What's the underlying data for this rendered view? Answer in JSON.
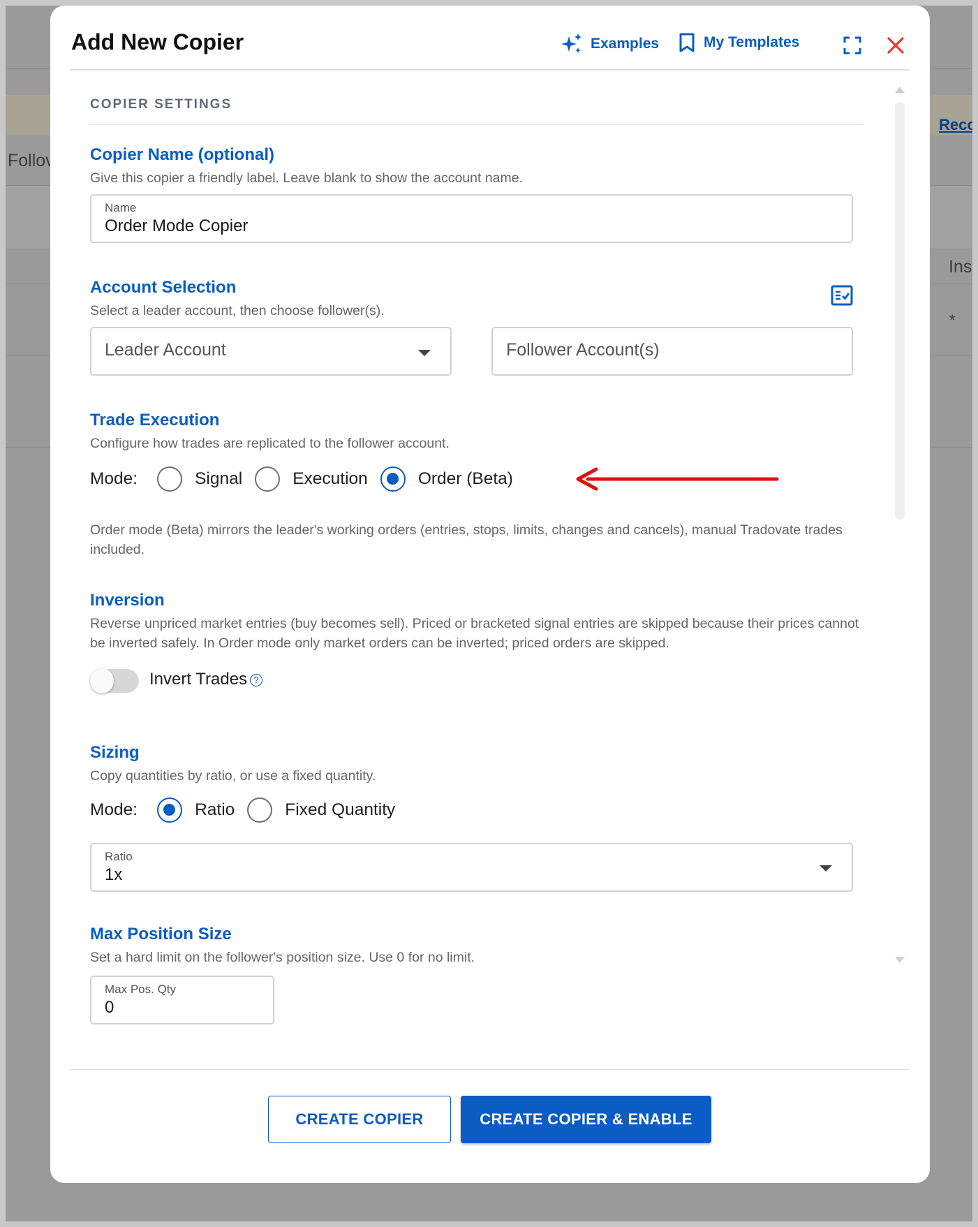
{
  "background": {
    "link_text": "Reco",
    "follow_text": "Follov",
    "ins_text": "Ins",
    "asterisk": "*"
  },
  "modal": {
    "title": "Add New Copier",
    "examples_label": "Examples",
    "templates_label": "My Templates"
  },
  "settings": {
    "section_caption": "COPIER SETTINGS",
    "copier_name": {
      "heading": "Copier Name (optional)",
      "description": "Give this copier a friendly label. Leave blank to show the account name.",
      "field_label": "Name",
      "field_value": "Order Mode Copier"
    },
    "account_selection": {
      "heading": "Account Selection",
      "description": "Select a leader account, then choose follower(s).",
      "leader_placeholder": "Leader Account",
      "follower_placeholder": "Follower Account(s)"
    },
    "trade_execution": {
      "heading": "Trade Execution",
      "description": "Configure how trades are replicated to the follower account.",
      "mode_label": "Mode:",
      "options": [
        "Signal",
        "Execution",
        "Order (Beta)"
      ],
      "selected": "Order (Beta)",
      "note": "Order mode (Beta) mirrors the leader's working orders (entries, stops, limits, changes and cancels), manual Tradovate trades included."
    },
    "inversion": {
      "heading": "Inversion",
      "description": "Reverse unpriced market entries (buy becomes sell). Priced or bracketed signal entries are skipped because their prices cannot be inverted safely. In Order mode only market orders can be inverted; priced orders are skipped.",
      "toggle_label": "Invert Trades",
      "toggle_on": false,
      "help_glyph": "?"
    },
    "sizing": {
      "heading": "Sizing",
      "description": "Copy quantities by ratio, or use a fixed quantity.",
      "mode_label": "Mode:",
      "options": [
        "Ratio",
        "Fixed Quantity"
      ],
      "selected": "Ratio",
      "ratio_label": "Ratio",
      "ratio_value": "1x"
    },
    "max_position": {
      "heading": "Max Position Size",
      "description": "Set a hard limit on the follower's position size. Use 0 for no limit.",
      "field_label": "Max Pos. Qty",
      "field_value": "0"
    }
  },
  "footer": {
    "create_label": "CREATE COPIER",
    "create_enable_label": "CREATE COPIER & ENABLE"
  },
  "colors": {
    "accent": "#0a5dc2",
    "close": "#e53935",
    "annotation_arrow": "#e01010"
  },
  "icons": [
    "sparkle-icon",
    "bookmark-icon",
    "fullscreen-icon",
    "close-icon",
    "checklist-icon",
    "chevron-down-icon",
    "help-icon",
    "red-arrow-annotation"
  ]
}
